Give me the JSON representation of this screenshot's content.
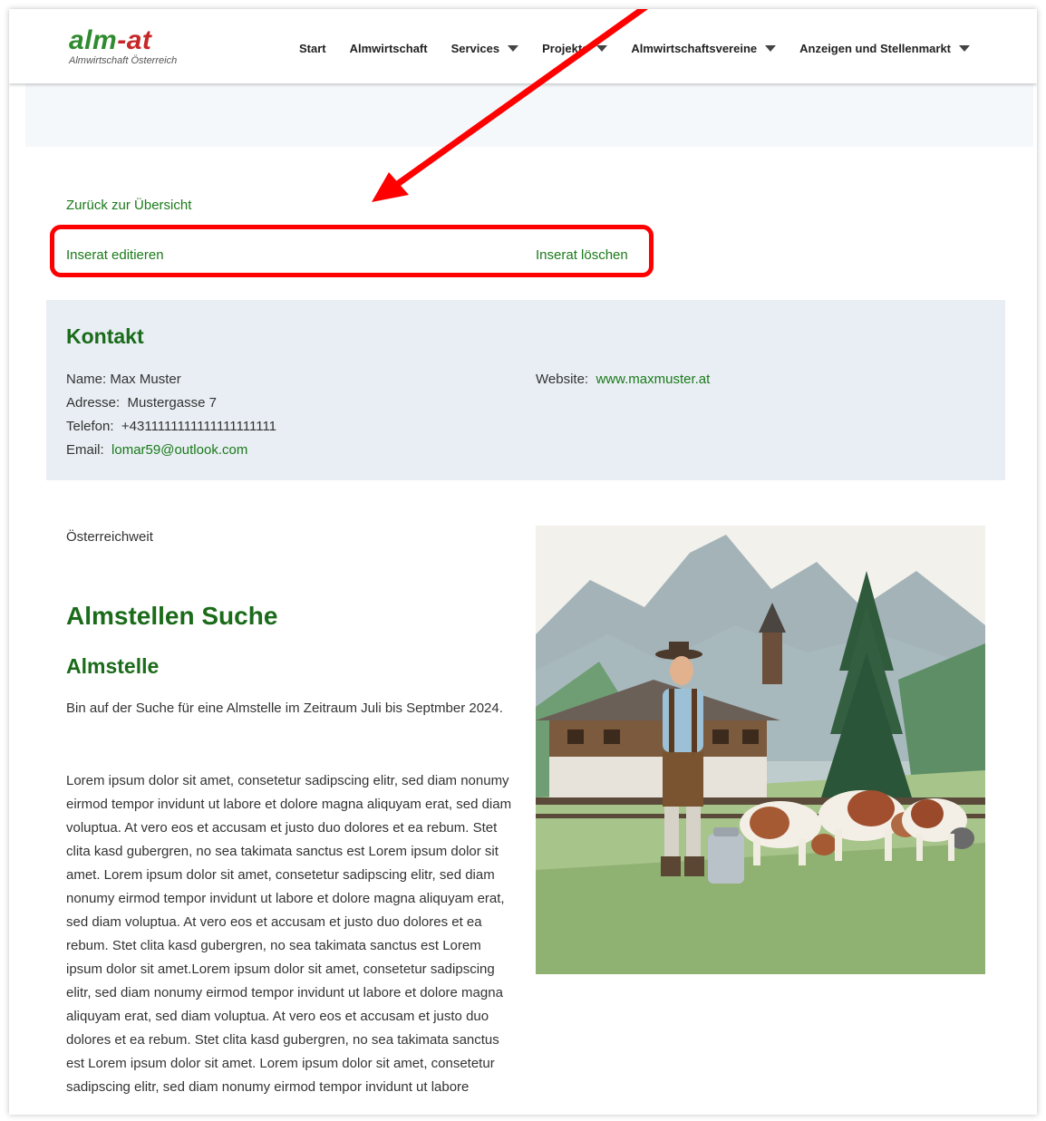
{
  "logo": {
    "prefix": "alm",
    "dash": "-",
    "suffix": "at",
    "subtitle": "Almwirtschaft Österreich"
  },
  "nav": {
    "items": [
      {
        "label": "Start",
        "dropdown": false
      },
      {
        "label": "Almwirtschaft",
        "dropdown": false
      },
      {
        "label": "Services",
        "dropdown": true
      },
      {
        "label": "Projekte",
        "dropdown": true
      },
      {
        "label": "Almwirtschaftsvereine",
        "dropdown": true
      },
      {
        "label": "Anzeigen und Stellenmarkt",
        "dropdown": true
      }
    ]
  },
  "links": {
    "back": "Zurück zur Übersicht",
    "edit": "Inserat editieren",
    "delete": "Inserat löschen"
  },
  "contact": {
    "heading": "Kontakt",
    "name": "Name: Max Muster",
    "address_label": "Adresse:",
    "address": "Mustergasse 7",
    "phone_label": "Telefon:",
    "phone": "+4311111111111111111111",
    "email_label": "Email:",
    "email": "lomar59@outlook.com",
    "website_label": "Website:",
    "website": "www.maxmuster.at"
  },
  "listing": {
    "region": "Österreichweit",
    "title": "Almstellen Suche",
    "subtitle": "Almstelle",
    "intro": "Bin auf der Suche für eine Almstelle im Zeitraum Juli bis Septmber 2024.",
    "body": "Lorem ipsum dolor sit amet, consetetur sadipscing elitr, sed diam nonumy eirmod tempor invidunt ut labore et dolore magna aliquyam erat, sed diam voluptua. At vero eos et accusam et justo duo dolores et ea rebum. Stet clita kasd gubergren, no sea takimata sanctus est Lorem ipsum dolor sit amet. Lorem ipsum dolor sit amet, consetetur sadipscing elitr, sed diam nonumy eirmod tempor invidunt ut labore et dolore magna aliquyam erat, sed diam voluptua. At vero eos et accusam et justo duo dolores et ea rebum. Stet clita kasd gubergren, no sea takimata sanctus est Lorem ipsum dolor sit amet.Lorem ipsum dolor sit amet, consetetur sadipscing elitr, sed diam nonumy eirmod tempor invidunt ut labore et dolore magna aliquyam erat, sed diam voluptua. At vero eos et accusam et justo duo dolores et ea rebum. Stet clita kasd gubergren, no sea takimata sanctus est Lorem ipsum dolor sit amet. Lorem ipsum dolor sit amet, consetetur sadipscing elitr, sed diam nonumy eirmod tempor invidunt ut labore"
  },
  "colors": {
    "brand_green": "#1a6b1a",
    "link_green": "#1a7a1a",
    "logo_red": "#c62828",
    "annotation_red": "#ff0000",
    "contact_bg": "#e8eef3"
  }
}
